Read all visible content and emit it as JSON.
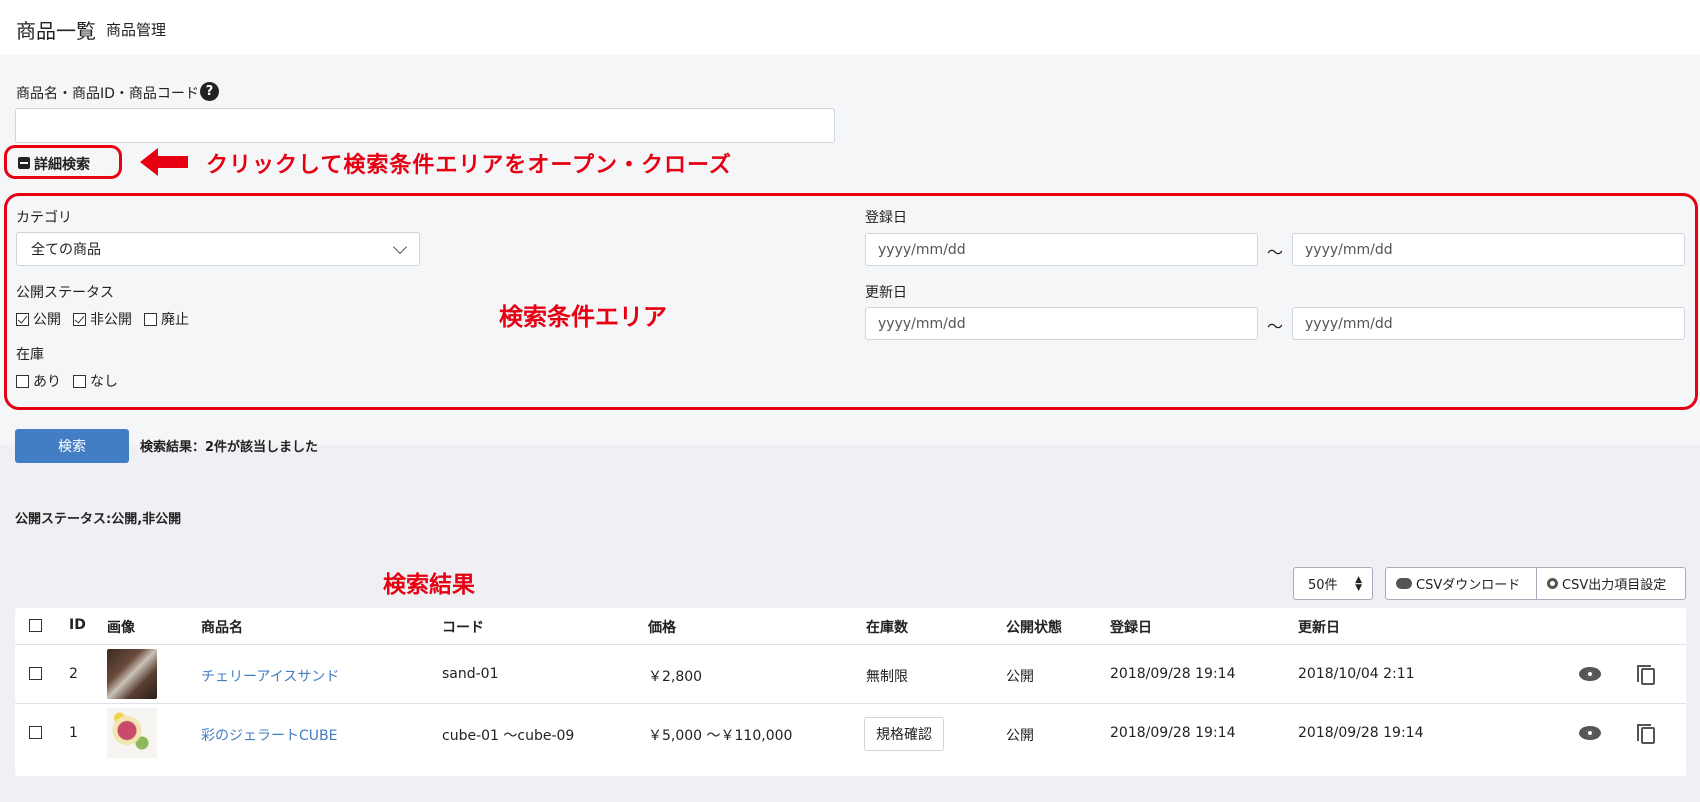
{
  "header": {
    "title": "商品一覧",
    "subtitle": "商品管理"
  },
  "search": {
    "keyword_label": "商品名・商品ID・商品コード",
    "keyword_value": "",
    "help_icon": "?",
    "detail_toggle_label": "詳細検索"
  },
  "annotations": {
    "toggle_note": "クリックして検索条件エリアをオープン・クローズ",
    "area_note": "検索条件エリア",
    "results_note": "検索結果"
  },
  "conditions": {
    "category_label": "カテゴリ",
    "category_value": "全ての商品",
    "status_label": "公開ステータス",
    "status_options": [
      {
        "label": "公開",
        "checked": true
      },
      {
        "label": "非公開",
        "checked": true
      },
      {
        "label": "廃止",
        "checked": false
      }
    ],
    "stock_label": "在庫",
    "stock_options": [
      {
        "label": "あり",
        "checked": false
      },
      {
        "label": "なし",
        "checked": false
      }
    ],
    "registered_label": "登録日",
    "updated_label": "更新日",
    "date_placeholder": "yyyy/mm/dd",
    "tilde": "～"
  },
  "search_button_label": "検索",
  "result_count_text": "検索結果：2件が該当しました",
  "applied_filter_text": "公開ステータス:公開,非公開",
  "toolbar": {
    "per_page": "50件",
    "csv_download_label": "CSVダウンロード",
    "csv_settings_label": "CSV出力項目設定"
  },
  "table": {
    "headers": [
      "ID",
      "画像",
      "商品名",
      "コード",
      "価格",
      "在庫数",
      "公開状態",
      "登録日",
      "更新日"
    ],
    "rows": [
      {
        "id": "2",
        "name": "チェリーアイスサンド",
        "code": "sand-01",
        "price": "￥2,800",
        "stock": "無制限",
        "status": "公開",
        "registered": "2018/09/28 19:14",
        "updated": "2018/10/04 2:11"
      },
      {
        "id": "1",
        "name": "彩のジェラートCUBE",
        "code": "cube-01 ～cube-09",
        "price": "￥5,000 ～￥110,000",
        "stock": "規格確認",
        "status": "公開",
        "registered": "2018/09/28 19:14",
        "updated": "2018/09/28 19:14"
      }
    ]
  },
  "colors": {
    "accent": "#437ec4",
    "annotation": "#e60012"
  }
}
